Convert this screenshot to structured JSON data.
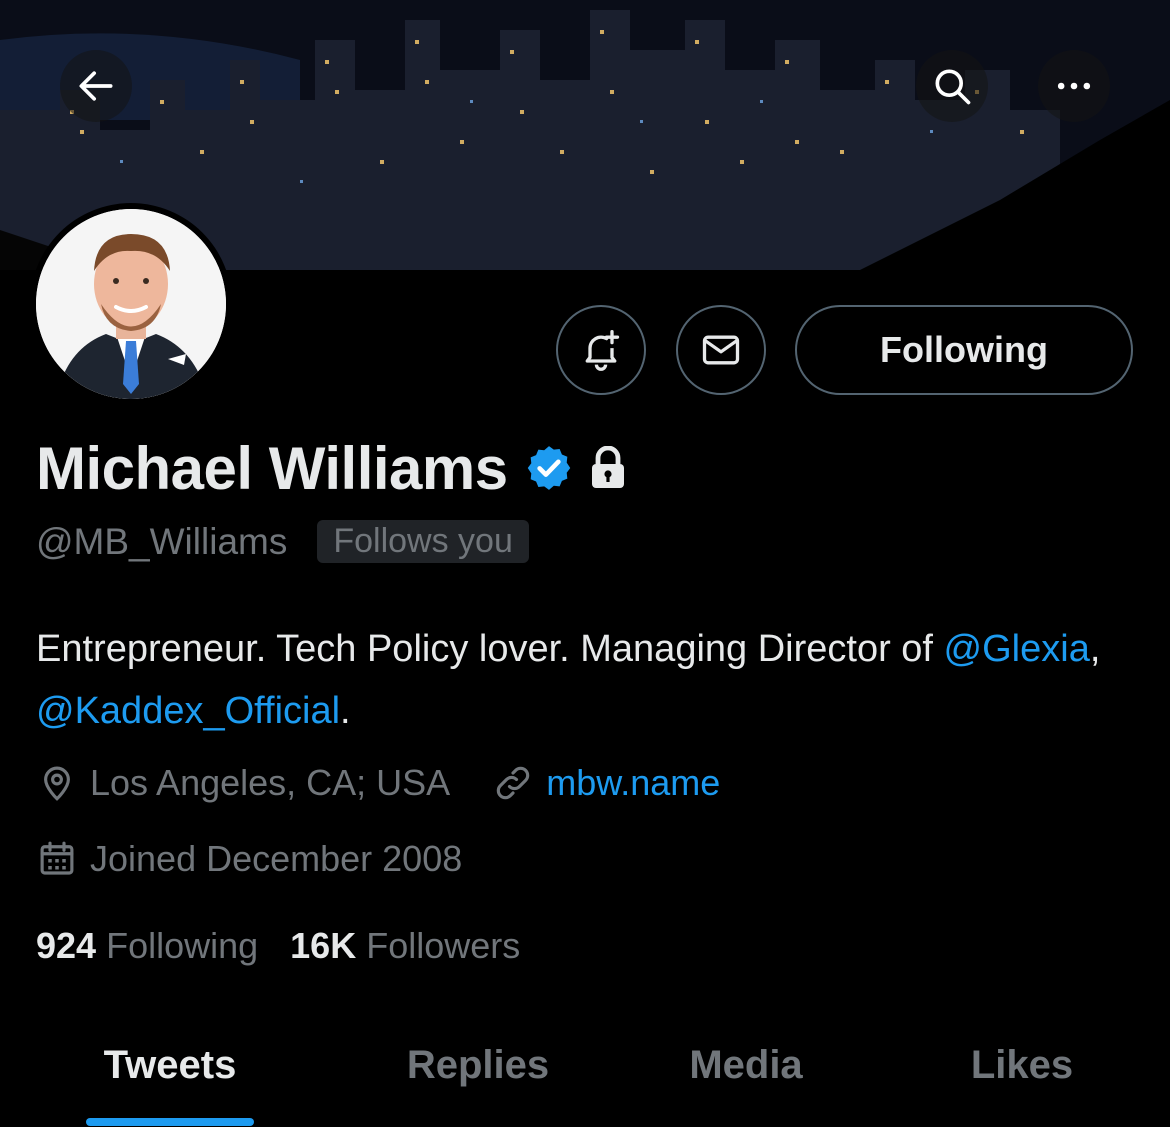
{
  "profile": {
    "name": "Michael Williams",
    "handle": "@MB_Williams",
    "follows_you": "Follows you",
    "following_button": "Following",
    "verified_color": "#1d9bf0"
  },
  "bio": {
    "text": "Entrepreneur. Tech Policy lover. Managing Director of ",
    "mention1": "@Glexia",
    "sep": ", ",
    "mention2": "@Kaddex_Official",
    "end": "."
  },
  "meta": {
    "location": "Los Angeles, CA; USA",
    "website": "mbw.name",
    "joined": "Joined December 2008"
  },
  "stats": {
    "following_count": "924",
    "following_label": "Following",
    "followers_count": "16K",
    "followers_label": "Followers"
  },
  "tabs": [
    {
      "label": "Tweets",
      "active": true
    },
    {
      "label": "Replies",
      "active": false
    },
    {
      "label": "Media",
      "active": false
    },
    {
      "label": "Likes",
      "active": false
    }
  ],
  "colors": {
    "accent": "#1d9bf0",
    "secondary_text": "#71767b",
    "primary_text": "#e7e9ea"
  }
}
